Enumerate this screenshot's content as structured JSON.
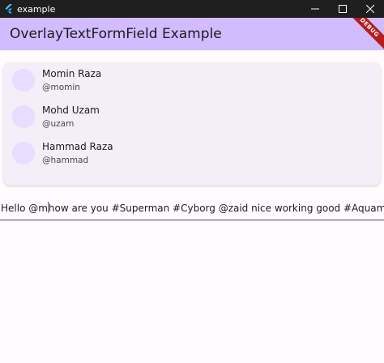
{
  "window": {
    "title": "example",
    "controls": [
      "minimize",
      "maximize",
      "close"
    ]
  },
  "appbar": {
    "title": "OverlayTextFormField Example",
    "debug_label": "DEBUG"
  },
  "suggestions": [
    {
      "name": "Momin Raza",
      "handle": "@momin"
    },
    {
      "name": "Mohd Uzam",
      "handle": "@uzam"
    },
    {
      "name": "Hammad Raza",
      "handle": "@hammad"
    }
  ],
  "textfield": {
    "before_cursor": "Hello @m",
    "after_cursor": "how are you #Superman #Cyborg @zaid nice working good #Aquaman"
  },
  "colors": {
    "appbar": "#d0bcff",
    "background": "#fffbfe",
    "card": "#f3eef7",
    "avatar": "#eadcff",
    "titlebar": "#1f1f1f",
    "debug_ribbon": "#b71c1c"
  }
}
